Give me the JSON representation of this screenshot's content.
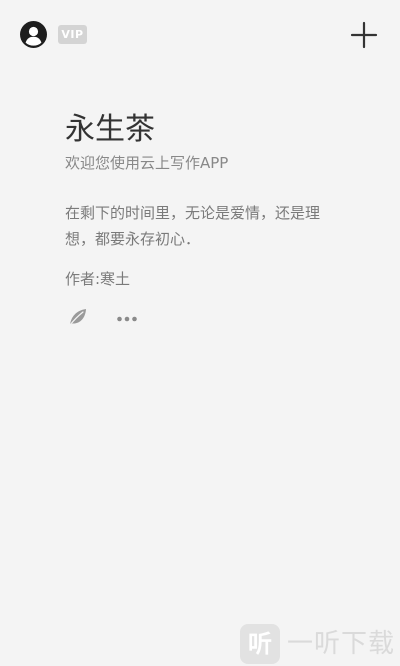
{
  "header": {
    "vip_label": "VIP",
    "icons": {
      "profile": "user-circle-icon",
      "add": "plus-icon"
    }
  },
  "card": {
    "title": "永生茶",
    "subtitle": "欢迎您使用云上写作APP",
    "content": "在剩下的时间里，无论是爱情，还是理想，都要永存初心．",
    "author": "作者:寒土",
    "icons": {
      "leaf": "leaf-icon",
      "more": "more-dots-icon"
    }
  },
  "watermark": {
    "logo_char": "听",
    "text": "一听下载"
  },
  "colors": {
    "background": "#f4f4f4",
    "title": "#333333",
    "text": "#7a7a7a",
    "vip_badge": "#d4d4d4"
  }
}
